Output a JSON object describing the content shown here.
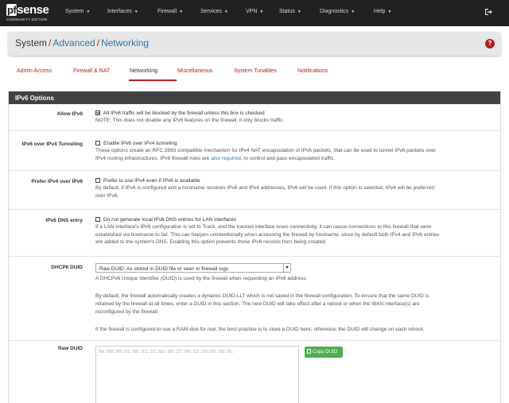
{
  "navbar": {
    "logo_main": "sense",
    "logo_prefix": "pf",
    "logo_sub": "COMMUNITY EDITION",
    "items": [
      {
        "label": "System"
      },
      {
        "label": "Interfaces"
      },
      {
        "label": "Firewall"
      },
      {
        "label": "Services"
      },
      {
        "label": "VPN"
      },
      {
        "label": "Status"
      },
      {
        "label": "Diagnostics"
      },
      {
        "label": "Help"
      }
    ]
  },
  "breadcrumb": {
    "part1": "System",
    "sep1": "/",
    "part2": "Advanced",
    "sep2": "/",
    "part3": "Networking"
  },
  "tabs": [
    {
      "label": "Admin Access",
      "active": false
    },
    {
      "label": "Firewall & NAT",
      "active": false
    },
    {
      "label": "Networking",
      "active": true
    },
    {
      "label": "Miscellaneous",
      "active": false
    },
    {
      "label": "System Tunables",
      "active": false
    },
    {
      "label": "Notifications",
      "active": false
    }
  ],
  "panel": {
    "heading": "IPv6 Options",
    "allow_ipv6": {
      "label": "Allow IPv6",
      "checkbox_text": "All IPv6 traffic will be blocked by the firewall unless this box is checked",
      "checked": true,
      "note": "NOTE: This does not disable any IPv6 features on the firewall, it only blocks traffic."
    },
    "ipv6_over_ipv4": {
      "label": "IPv6 over IPv4 Tunneling",
      "checkbox_text": "Enable IPv6 over IPv4 tunneling",
      "checked": false,
      "help_line1": "These options create an RFC 2893 compatible mechanism for IPv4 NAT encapsulation of IPv6 packets, that can be used to tunnel IPv6 packets over",
      "help_line2_a": "IPv4 routing infrastructures. IPv6 firewall rules are ",
      "help_line2_link": "also required",
      "help_line2_b": ", to control and pass encapsulated traffic."
    },
    "prefer_ipv4": {
      "label": "Prefer IPv4 over IPv6",
      "checkbox_text": "Prefer to use IPv4 even if IPv6 is available",
      "checked": false,
      "help_line1": "By default, if IPv6 is configured and a hostname resolves IPv6 and IPv4 addresses, IPv6 will be used. If this option is selected, IPv4 will be preferred",
      "help_line2": "over IPv6."
    },
    "ipv6_dns": {
      "label": "IPv6 DNS entry",
      "checkbox_text": "Do not generate local IPv6 DNS entries for LAN interfaces",
      "checked": false,
      "help_line1": "If a LAN interface's IPv6 configuration is set to Track, and the tracked interface loses connectivity, it can cause connections to this firewall that were",
      "help_line2": "established via hostname to fail. This can happen unintentionally when accessing the firewall by hostname, since by default both IPv4 and IPv6 entries",
      "help_line3": "are added to the system's DNS. Enabling this option prevents those IPv6 records from being created."
    },
    "dhcp6_duid": {
      "label": "DHCP6 DUID",
      "select_value": "Raw DUID: As stored in DUID file or seen in firewall logs",
      "help_line1": "A DHCPv6 Unique Identifier (DUID) is used by the firewall when requesting an IPv6 address.",
      "help_line2": "By default, the firewall automatically creates a dynamic DUID-LLT which is not saved in the firewall configuration. To ensure that the same DUID is",
      "help_line3": "retained by the firewall at all times, enter a DUID in this section. The new DUID will take effect after a reboot or when the WAN interface(s) are",
      "help_line4": "reconfigured by the firewall.",
      "help_line5": "If the firewall is configured to use a RAM disk for /var, the best practice is to store a DUID here; otherwise, the DUID will change on each reboot."
    },
    "raw_duid": {
      "label": "Raw DUID",
      "placeholder": "0e:00:00:01:00:01:22:6a:98:1f:00:13:5d:03:03:0c",
      "copy_button": "Copy DUID"
    }
  },
  "colors": {
    "navbar_bg": "#212121",
    "accent_red": "#b22222",
    "link_blue": "#2d77a8",
    "panel_heading": "#424242",
    "button_green": "#4caf50"
  }
}
